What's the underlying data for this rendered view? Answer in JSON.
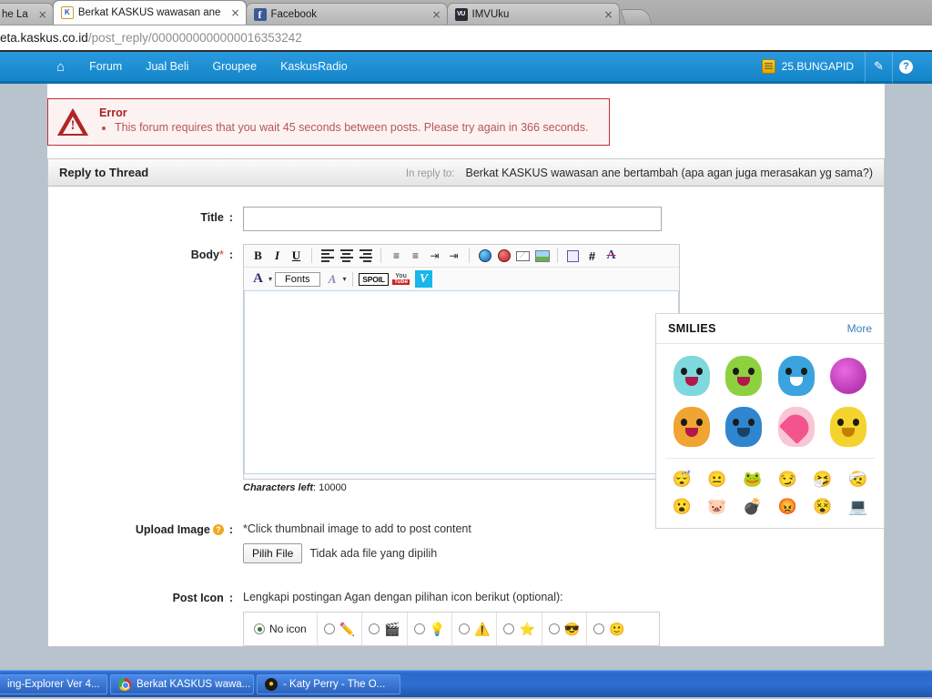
{
  "browser": {
    "tabs": [
      {
        "title": "he La",
        "favicon": "",
        "partial": true,
        "active": false
      },
      {
        "title": "Berkat KASKUS wawasan ane",
        "favicon": "kaskus-favicon",
        "partial": false,
        "active": true
      },
      {
        "title": "Facebook",
        "favicon": "facebook-favicon",
        "partial": false,
        "active": false
      },
      {
        "title": "IMVUku",
        "favicon": "imvu-favicon",
        "partial": false,
        "active": false
      }
    ],
    "close_glyph": "×",
    "url_host": "eta.kaskus.co.id",
    "url_path": "/post_reply/0000000000000016353242"
  },
  "navbar": {
    "home_icon": "⌂",
    "items": [
      "Forum",
      "Jual Beli",
      "Groupee",
      "KaskusRadio"
    ],
    "username": "25.BUNGAPID",
    "edit_icon": "✎",
    "help_icon": "?",
    "bg_color": "#1b8bd0"
  },
  "error": {
    "title": "Error",
    "messages": [
      "This forum requires that you wait 45 seconds between posts. Please try again in 366 seconds."
    ],
    "border_color": "#c03030",
    "bg_color": "#fdf2f2"
  },
  "reply_panel": {
    "heading": "Reply to Thread",
    "in_reply_label": "In reply to:",
    "in_reply_title": "Berkat KASKUS wawasan ane bertambah (apa agan juga merasakan yg sama?)"
  },
  "form": {
    "title_label": "Title",
    "title_colon": ":",
    "title_value": "",
    "body_label": "Body",
    "body_required": "*",
    "body_colon": ":",
    "body_value": "",
    "chars_left_label": "Characters left",
    "chars_left_value": "10000",
    "upload_label": "Upload Image",
    "upload_colon": ":",
    "upload_help_icon": "?",
    "upload_note": "*Click thumbnail image to add to post content",
    "file_button": "Pilih File",
    "file_status": "Tidak ada file yang dipilih",
    "posticon_label": "Post Icon",
    "posticon_colon": ":",
    "posticon_note": "Lengkapi postingan Agan dengan pilihan icon berikut (optional):",
    "no_icon_label": "No icon"
  },
  "toolbar": {
    "row1": [
      {
        "name": "bold",
        "glyph": "B"
      },
      {
        "name": "italic",
        "glyph": "I"
      },
      {
        "name": "underline",
        "glyph": "U"
      },
      {
        "name": "align-left",
        "glyph": ""
      },
      {
        "name": "align-center",
        "glyph": ""
      },
      {
        "name": "align-right",
        "glyph": ""
      },
      {
        "name": "bullet-list",
        "glyph": "≡"
      },
      {
        "name": "numbered-list",
        "glyph": "≡"
      },
      {
        "name": "outdent",
        "glyph": "≡"
      },
      {
        "name": "indent",
        "glyph": "≡"
      },
      {
        "name": "insert-link",
        "glyph": ""
      },
      {
        "name": "remove-link",
        "glyph": ""
      },
      {
        "name": "insert-email",
        "glyph": ""
      },
      {
        "name": "insert-image",
        "glyph": ""
      },
      {
        "name": "insert-quote",
        "glyph": ""
      },
      {
        "name": "insert-code",
        "glyph": "#"
      },
      {
        "name": "remove-format",
        "glyph": "A"
      }
    ],
    "font_color_glyph": "A",
    "fonts_label": "Fonts",
    "font_size_glyph": "A",
    "spoil_label": "SPOIL",
    "youtube_top": "You",
    "youtube_bottom": "Tube",
    "vimeo_glyph": "V"
  },
  "smilies": {
    "title": "SMILIES",
    "more_label": "More",
    "big": [
      {
        "name": "smiley-shock-cyan",
        "color": "#7fd8de"
      },
      {
        "name": "smiley-alien-green",
        "color": "#8ed13f"
      },
      {
        "name": "smiley-grin-blue",
        "color": "#3aa3e0"
      },
      {
        "name": "smiley-genie-purple",
        "color": "#c63ac0"
      },
      {
        "name": "smiley-laugh-orange",
        "color": "#f0a431"
      },
      {
        "name": "smiley-starry-eyes-blue",
        "color": "#2f86cf"
      },
      {
        "name": "smiley-love-heart-pink",
        "color": "#f48fb1"
      },
      {
        "name": "smiley-shy-yellow",
        "color": "#f5d32e"
      }
    ],
    "small_row1": [
      {
        "name": "smiley-sleep-blue",
        "glyph": "😴",
        "color": "#3b8fd0"
      },
      {
        "name": "smiley-plain-yellow",
        "glyph": "😐",
        "color": "#f5d32e"
      },
      {
        "name": "smiley-frog-green",
        "glyph": "🐸",
        "color": "#9ccc3f"
      },
      {
        "name": "smiley-smirk-yellow",
        "glyph": "😏",
        "color": "#f5c93a"
      },
      {
        "name": "smiley-tissue-cyan",
        "glyph": "🤧",
        "color": "#9fdde8"
      },
      {
        "name": "smiley-injured-white",
        "glyph": "🤕",
        "color": "#dcdcdc"
      }
    ],
    "small_row2": [
      {
        "name": "smiley-shout-yellow",
        "glyph": "😮",
        "color": "#f5d32e"
      },
      {
        "name": "smiley-pig-pink",
        "glyph": "🐷",
        "color": "#f6b8c8"
      },
      {
        "name": "smiley-bomb-black",
        "glyph": "💣",
        "color": "#2b2b2b"
      },
      {
        "name": "smiley-angry-red",
        "glyph": "😡",
        "color": "#e04040"
      },
      {
        "name": "smiley-dizzy-orange",
        "glyph": "😵",
        "color": "#f0902e"
      },
      {
        "name": "smiley-computer-gray",
        "glyph": "💻",
        "color": "#cfcfcf"
      }
    ]
  },
  "post_icons": [
    {
      "name": "post-icon-pencil",
      "glyph": "✏️",
      "selected": false
    },
    {
      "name": "post-icon-clapperboard",
      "glyph": "🎬",
      "selected": false
    },
    {
      "name": "post-icon-lightbulb",
      "glyph": "💡",
      "selected": false
    },
    {
      "name": "post-icon-warning",
      "glyph": "⚠️",
      "selected": false
    },
    {
      "name": "post-icon-star",
      "glyph": "⭐",
      "selected": false
    },
    {
      "name": "post-icon-cool-face",
      "glyph": "😎",
      "selected": false
    },
    {
      "name": "post-icon-smiley",
      "glyph": "🙂",
      "selected": false
    }
  ],
  "taskbar": {
    "items": [
      {
        "label": "ing-Explorer Ver 4...",
        "icon": "none"
      },
      {
        "label": "Berkat KASKUS wawa...",
        "icon": "chrome-icon"
      },
      {
        "label": "- Katy Perry - The O...",
        "icon": "media-player-icon"
      }
    ]
  }
}
